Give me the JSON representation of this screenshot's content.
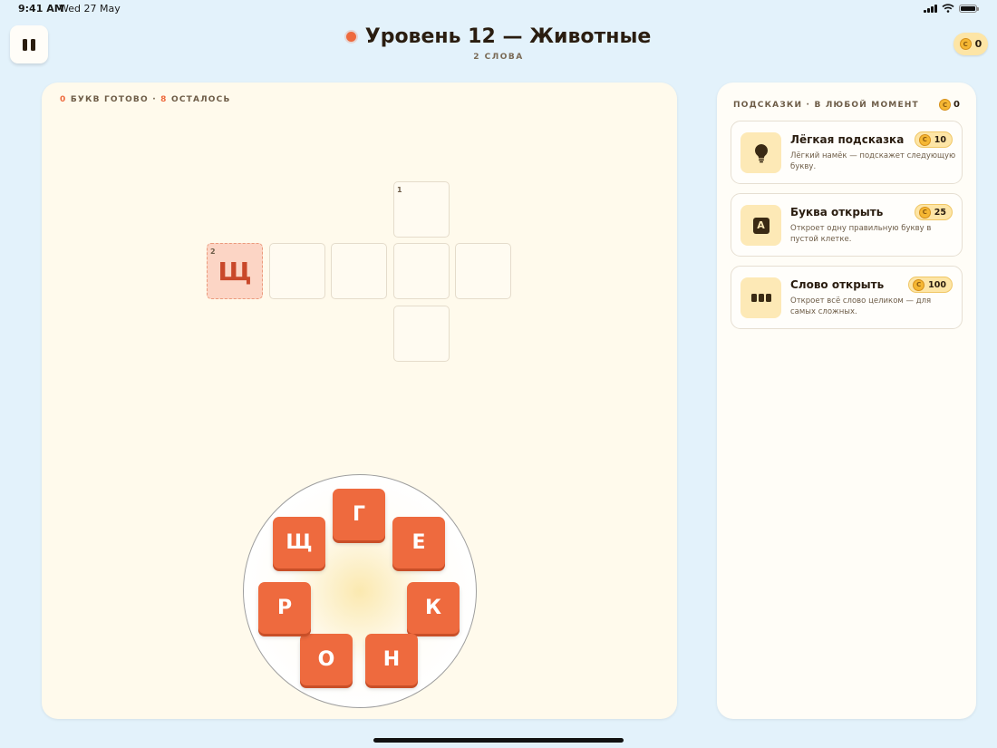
{
  "status_bar": {
    "time": "9:41 AM",
    "date": "Wed 27 May"
  },
  "header": {
    "title": "Уровень 12 — Животные",
    "subtitle": "2 СЛОВА",
    "coins": "0",
    "pause_icon": "pause-icon",
    "accent_color": "#ee6a3e"
  },
  "board": {
    "progress": {
      "done": "0",
      "done_label": "БУКВ ГОТОВО",
      "separator": " · ",
      "left": "8",
      "left_label": "ОСТАЛОСЬ"
    },
    "cells": [
      {
        "number": "1",
        "letter": "",
        "revealed": false
      },
      {
        "number": "2",
        "letter": "Щ",
        "revealed": true
      },
      {
        "number": "",
        "letter": "",
        "revealed": false
      },
      {
        "number": "",
        "letter": "",
        "revealed": false
      },
      {
        "number": "",
        "letter": "",
        "revealed": false
      },
      {
        "number": "",
        "letter": "",
        "revealed": false
      },
      {
        "number": "",
        "letter": "",
        "revealed": false
      }
    ],
    "wheel_letters": [
      "Г",
      "Е",
      "К",
      "Н",
      "О",
      "Р",
      "Щ"
    ]
  },
  "hints": {
    "heading": "ПОДСКАЗКИ · В ЛЮБОЙ МОМЕНТ",
    "balance": "0",
    "coin_glyph": "C",
    "items": [
      {
        "name": "Лёгкая подсказка",
        "price": "10",
        "desc": "Лёгкий намёк — подскажет следующую букву.",
        "icon": "lightbulb-icon"
      },
      {
        "name": "Буква открыть",
        "price": "25",
        "desc": "Откроет одну правильную букву в пустой клетке.",
        "icon": "letter-a-icon",
        "icon_text": "А"
      },
      {
        "name": "Слово открыть",
        "price": "100",
        "desc": "Откроет всё слово целиком — для самых сложных.",
        "icon": "word-blocks-icon"
      }
    ]
  }
}
